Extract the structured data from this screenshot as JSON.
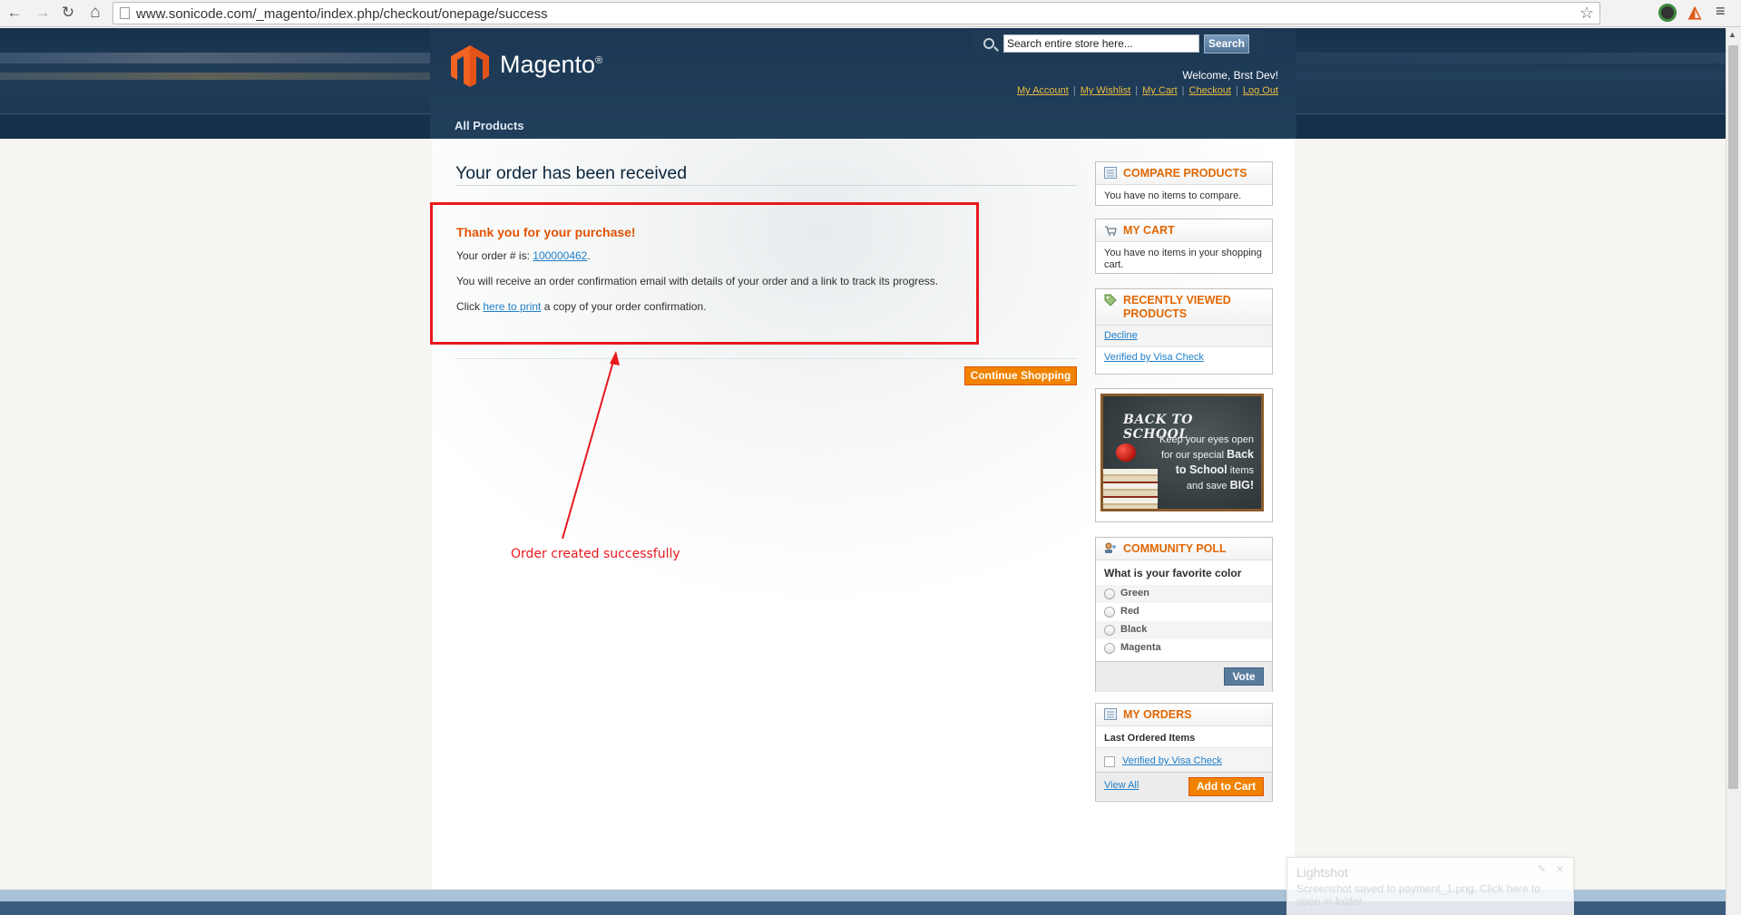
{
  "browser": {
    "url": "www.sonicode.com/_magento/index.php/checkout/onepage/success",
    "back_glyph": "←",
    "forward_glyph": "→",
    "reload_glyph": "↻",
    "home_glyph": "⌂",
    "star_glyph": "☆",
    "menu_glyph": "≡"
  },
  "header": {
    "logo_text": "Magento",
    "logo_reg": "®",
    "search_placeholder": "Search entire store here...",
    "search_button": "Search",
    "welcome": "Welcome, Brst Dev!",
    "links": [
      "My Account",
      "My Wishlist",
      "My Cart",
      "Checkout",
      "Log Out"
    ],
    "separator": "|",
    "accent_color": "#ebbb40"
  },
  "nav": {
    "all_products": "All Products"
  },
  "main": {
    "page_title": "Your order has been received",
    "thanks": "Thank you for your purchase!",
    "order_prefix": "Your order # is: ",
    "order_number": "100000462",
    "order_suffix": ".",
    "email_text": "You will receive an order confirmation email with details of your order and a link to track its progress.",
    "print_prefix": "Click ",
    "print_link": "here to print",
    "print_suffix": " a copy of your order confirmation.",
    "continue_button": "Continue Shopping"
  },
  "annotation": {
    "text": "Order created successfully",
    "color": "#e8191d"
  },
  "sidebar": {
    "compare": {
      "title": "Compare Products",
      "text": "You have no items to compare."
    },
    "cart": {
      "title": "My Cart",
      "text": "You have no items in your shopping cart."
    },
    "recently_viewed": {
      "title": "Recently Viewed Products",
      "items": [
        "Decline",
        "Verified by Visa Check"
      ]
    },
    "banner": {
      "title": "BACK TO SCHOOL",
      "line1": "Keep your eyes open",
      "line2": "for our special ",
      "bold1": "Back",
      "bold2": "to School",
      "line3": " items",
      "line4": "and save ",
      "bold3": "BIG!"
    },
    "poll": {
      "title": "Community Poll",
      "question": "What is your favorite color",
      "options": [
        "Green",
        "Red",
        "Black",
        "Magenta"
      ],
      "vote_button": "Vote"
    },
    "orders": {
      "title": "My Orders",
      "subtitle": "Last Ordered Items",
      "items": [
        "Verified by Visa Check"
      ],
      "view_all": "View All",
      "add_to_cart": "Add to Cart"
    }
  },
  "toast": {
    "title": "Lightshot",
    "body": "Screenshot saved to payment_1.png. Click here to open in folder.",
    "pin": "✎",
    "close": "✕"
  }
}
